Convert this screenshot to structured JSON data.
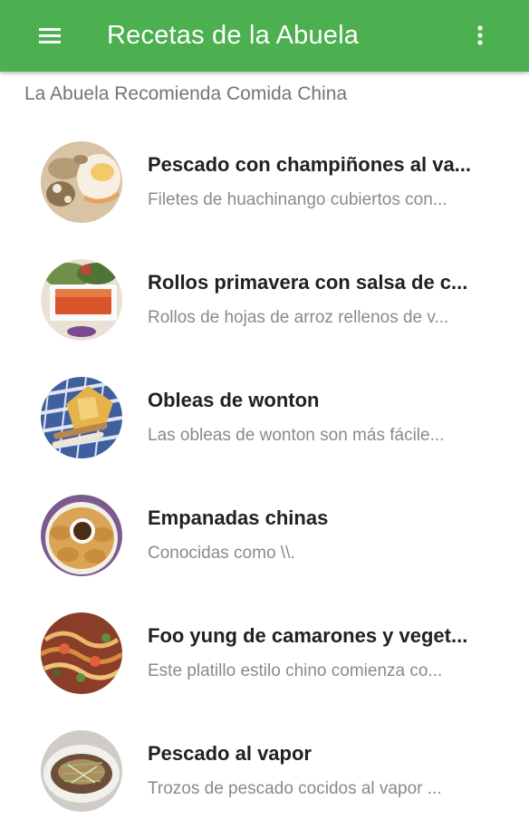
{
  "app_bar": {
    "title": "Recetas de la Abuela",
    "background_color": "#4caf50",
    "menu_icon": "hamburger-menu-icon",
    "overflow_icon": "more-vert-icon"
  },
  "section": {
    "header": "La Abuela Recomienda Comida China"
  },
  "recipes": [
    {
      "title": "Pescado con champiñones al va...",
      "description": "Filetes de huachinango cubiertos con...",
      "thumbnail": "fish-mushroom-dish-photo"
    },
    {
      "title": "Rollos primavera con salsa de c...",
      "description": "Rollos de hojas de arroz rellenos de v...",
      "thumbnail": "spring-rolls-sauce-photo"
    },
    {
      "title": "Obleas de wonton",
      "description": "Las obleas de wonton son más fácile...",
      "thumbnail": "wonton-wrappers-photo"
    },
    {
      "title": "Empanadas chinas",
      "description": "Conocidas como \\\\.",
      "thumbnail": "chinese-dumplings-photo"
    },
    {
      "title": "Foo yung de camarones y veget...",
      "description": "Este platillo estilo chino comienza co...",
      "thumbnail": "shrimp-foo-yung-photo"
    },
    {
      "title": "Pescado al vapor",
      "description": "Trozos de pescado cocidos al vapor ...",
      "thumbnail": "steamed-fish-photo"
    }
  ]
}
